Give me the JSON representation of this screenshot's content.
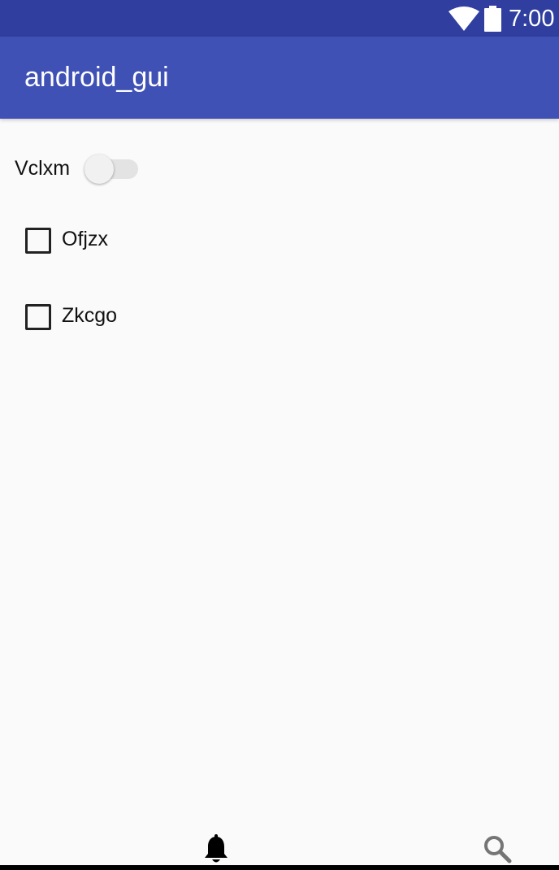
{
  "status_bar": {
    "time": "7:00",
    "icons": [
      "wifi-icon",
      "battery-icon"
    ],
    "background": "#303f9f"
  },
  "app_bar": {
    "title": "android_gui",
    "background": "#3f51b5"
  },
  "content": {
    "switch": {
      "label": "Vclxm",
      "checked": false
    },
    "checkboxes": [
      {
        "label": "Ofjzx",
        "checked": false
      },
      {
        "label": "Zkcgo",
        "checked": false
      }
    ]
  },
  "bottom_nav": {
    "icons": [
      "bell-icon",
      "search-icon"
    ]
  }
}
